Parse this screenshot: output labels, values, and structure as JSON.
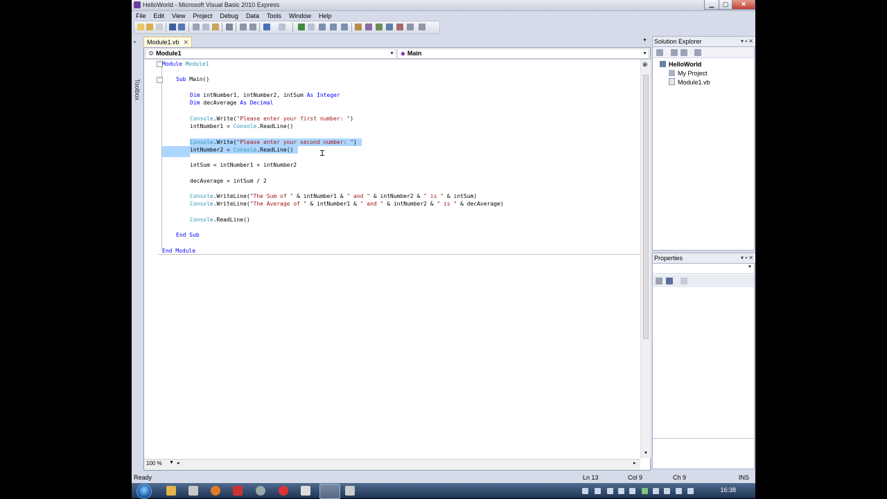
{
  "window": {
    "title": "HelloWorld - Microsoft Visual Basic 2010 Express",
    "min_glyph": "▁",
    "max_glyph": "▢",
    "close_glyph": "✕"
  },
  "menu": [
    "File",
    "Edit",
    "View",
    "Project",
    "Debug",
    "Data",
    "Tools",
    "Window",
    "Help"
  ],
  "toolbox_label": "Toolbox",
  "document_tab": {
    "label": "Module1.vb",
    "close_glyph": "✕"
  },
  "nav": {
    "class_combo": "Module1",
    "method_combo": "Main"
  },
  "code": {
    "line1": [
      "Module",
      " ",
      "Module1"
    ],
    "line2": [
      "Sub",
      " Main()"
    ],
    "line3": [
      "Dim",
      " intNumber1, intNumber2, intSum ",
      "As",
      " ",
      "Integer"
    ],
    "line4": [
      "Dim",
      " decAverage ",
      "As",
      " ",
      "Decimal"
    ],
    "line5": [
      "Console",
      ".Write(",
      "\"Please enter your first number: \"",
      ")"
    ],
    "line6": [
      "intNumber1 = ",
      "Console",
      ".ReadLine()"
    ],
    "line7": [
      "Console",
      ".Write(",
      "\"Please enter your second number: \"",
      ")"
    ],
    "line8": [
      "intNumber2 = ",
      "Console",
      ".ReadLine()"
    ],
    "line9": "intSum = intNumber1 + intNumber2",
    "line10": "decAverage = intSum / 2",
    "line11": [
      "Console",
      ".WriteLine(",
      "\"The Sum of \"",
      " & intNumber1 & ",
      "\" and \"",
      " & intNumber2 & ",
      "\" is \"",
      " & intSum)"
    ],
    "line12": [
      "Console",
      ".WriteLine(",
      "\"The Average of \"",
      " & intNumber1 & ",
      "\" and \"",
      " & intNumber2 & ",
      "\" is \"",
      " & decAverage)"
    ],
    "line13": [
      "Console",
      ".ReadLine()"
    ],
    "line14": [
      "End",
      " ",
      "Sub"
    ],
    "line15": [
      "End",
      " ",
      "Module"
    ]
  },
  "editor": {
    "zoom": "100 %"
  },
  "solution_explorer": {
    "title": "Solution Explorer",
    "items": [
      "HelloWorld",
      "My Project",
      "Module1.vb"
    ]
  },
  "properties": {
    "title": "Properties"
  },
  "status": {
    "state": "Ready",
    "line": "Ln 13",
    "col": "Col 9",
    "ch": "Ch 9",
    "mode": "INS"
  },
  "taskbar": {
    "clock": "16:38"
  }
}
